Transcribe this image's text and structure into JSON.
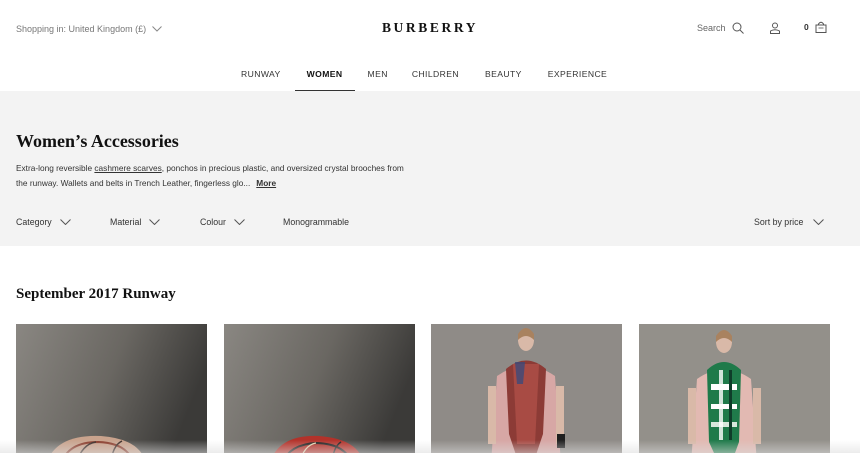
{
  "header": {
    "shopping_in": "Shopping in: United Kingdom (£)",
    "logo": "BURBERRY",
    "search_label": "Search",
    "bag_count": "0"
  },
  "nav": {
    "items": [
      {
        "label": "RUNWAY",
        "active": false
      },
      {
        "label": "WOMEN",
        "active": true
      },
      {
        "label": "MEN",
        "active": false
      },
      {
        "label": "CHILDREN",
        "active": false
      },
      {
        "label": "BEAUTY",
        "active": false
      },
      {
        "label": "EXPERIENCE",
        "active": false
      }
    ]
  },
  "category": {
    "title": "Women’s Accessories",
    "desc_prefix": "Extra-long reversible ",
    "desc_link": "cashmere scarves",
    "desc_rest": ", ponchos in precious plastic, and oversized crystal brooches from the runway. Wallets and belts in Trench Leather, fingerless glo...",
    "more_label": "More"
  },
  "filters": {
    "items": [
      "Category",
      "Material",
      "Colour",
      "Monogrammable"
    ],
    "sort_label": "Sort by price"
  },
  "section": {
    "title": "September 2017 Runway"
  },
  "colors": {
    "panel_bg": "#f3f3f3",
    "text": "#222222",
    "muted": "#777777"
  }
}
